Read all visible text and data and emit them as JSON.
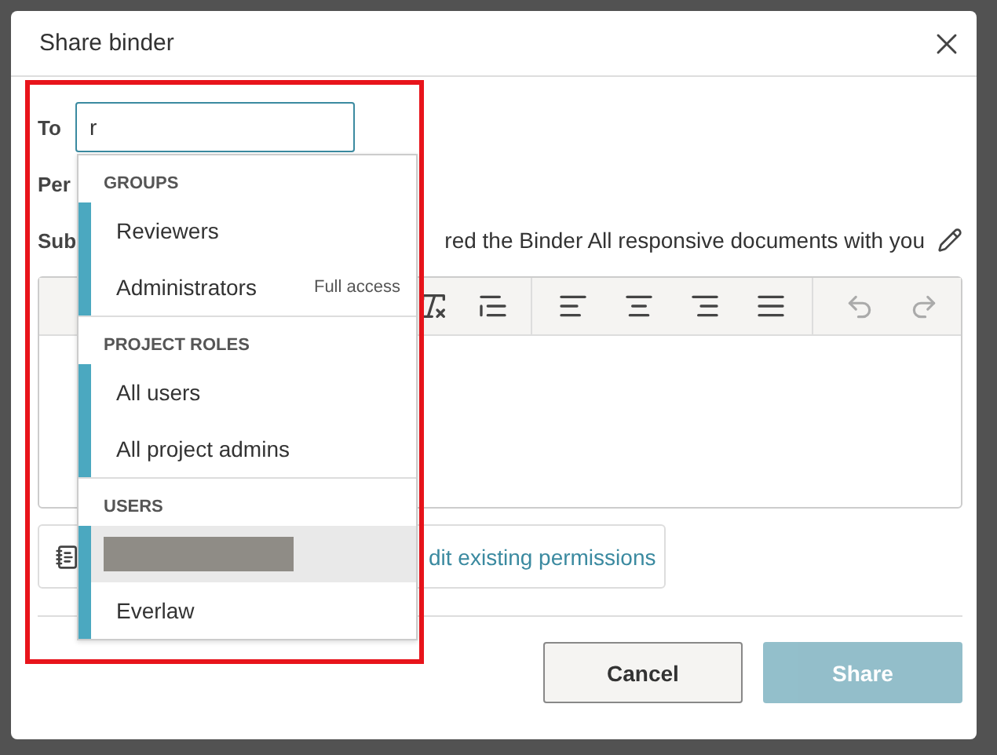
{
  "dialog": {
    "title": "Share binder"
  },
  "to": {
    "label": "To",
    "value": "r"
  },
  "permissions": {
    "label": "Per"
  },
  "subject": {
    "label": "Sub",
    "text": "red the Binder All responsive documents with you"
  },
  "edit_permissions": {
    "link": "dit existing permissions"
  },
  "dropdown": {
    "sections": [
      {
        "heading": "GROUPS",
        "items": [
          {
            "kind": "text",
            "label": "Reviewers",
            "highlighted": false
          },
          {
            "kind": "text",
            "label": "Administrators",
            "note": "Full access",
            "highlighted": false
          }
        ]
      },
      {
        "heading": "PROJECT ROLES",
        "items": [
          {
            "kind": "text",
            "label": "All users",
            "highlighted": false
          },
          {
            "kind": "text",
            "label": "All project admins",
            "highlighted": false
          }
        ]
      },
      {
        "heading": "USERS",
        "items": [
          {
            "kind": "redacted",
            "highlighted": true
          },
          {
            "kind": "text",
            "label": "Everlaw",
            "highlighted": false
          }
        ]
      }
    ]
  },
  "buttons": [
    {
      "label": "Cancel",
      "kind": "secondary",
      "disabled": false
    },
    {
      "label": "Share",
      "kind": "primary",
      "disabled": true
    }
  ]
}
